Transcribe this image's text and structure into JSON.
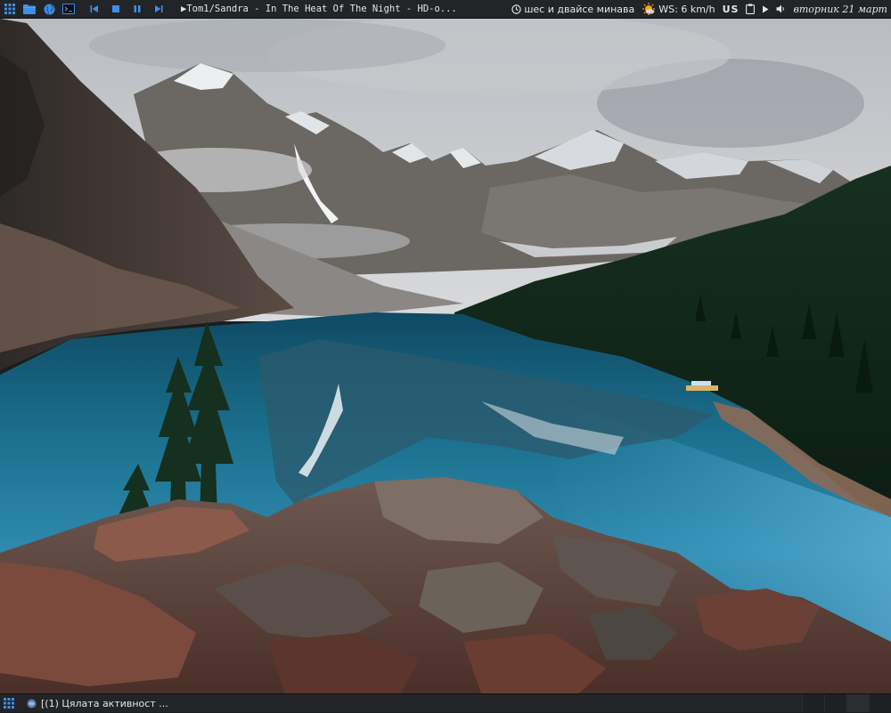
{
  "top_panel": {
    "launchers": [
      "grid-icon",
      "folder-icon",
      "globe-icon",
      "terminal-icon"
    ],
    "media_controls": [
      "skip-previous-icon",
      "stop-icon",
      "pause-icon",
      "skip-next-icon"
    ],
    "now_playing": "▶Tom1/Sandra - In The Heat Of The Night - HD-o...",
    "clock_text": "шес и двайсе минава",
    "weather_text": "WS: 6 km/h",
    "keyboard_layout": "US",
    "date_text": "вторник 21 март",
    "accent_color": "#3d8ee6"
  },
  "taskbar": {
    "task_label": "[(1) Цялата активност ...",
    "accent_color": "#3d8ee6"
  }
}
